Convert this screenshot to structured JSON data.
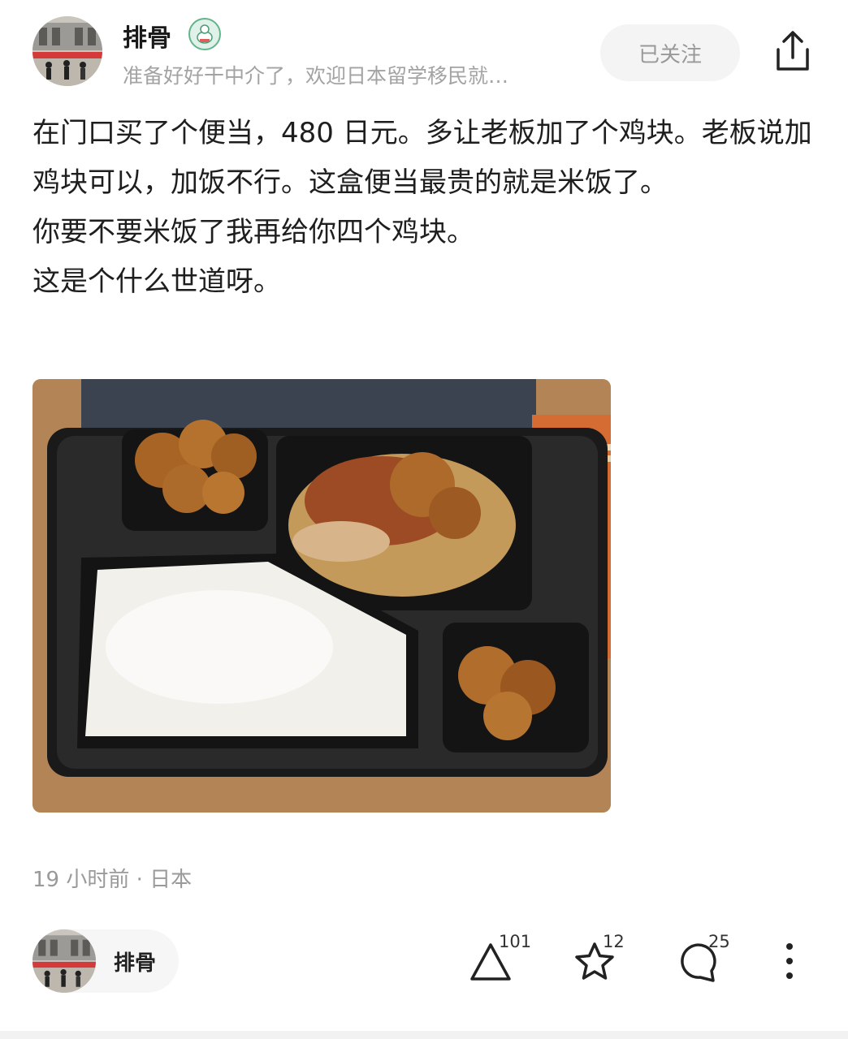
{
  "author": {
    "name": "排骨",
    "bio": "准备好好干中介了，欢迎日本留学移民就…",
    "badge_icon": "green-character-badge-icon"
  },
  "actions": {
    "follow_label": "已关注",
    "share_icon": "share-icon"
  },
  "post": {
    "paragraphs": [
      "在门口买了个便当，480 日元。多让老板加了个鸡块。老板说加鸡块可以，加饭不行。这盒便当最贵的就是米饭了。",
      "你要不要米饭了我再给你四个鸡块。",
      "这是个什么世道呀。"
    ],
    "image_description_icon": "bento-photo",
    "time": "19 小时前 · 日本"
  },
  "footer": {
    "author_name": "排骨",
    "likes": "101",
    "favorites": "12",
    "comments": "25",
    "icons": [
      "triangle-like-icon",
      "star-icon",
      "comment-bubble-icon",
      "more-vertical-icon"
    ]
  },
  "colors": {
    "text": "#1e1e1e",
    "muted": "#9a9a9a",
    "follow_bg": "#f4f4f4"
  }
}
